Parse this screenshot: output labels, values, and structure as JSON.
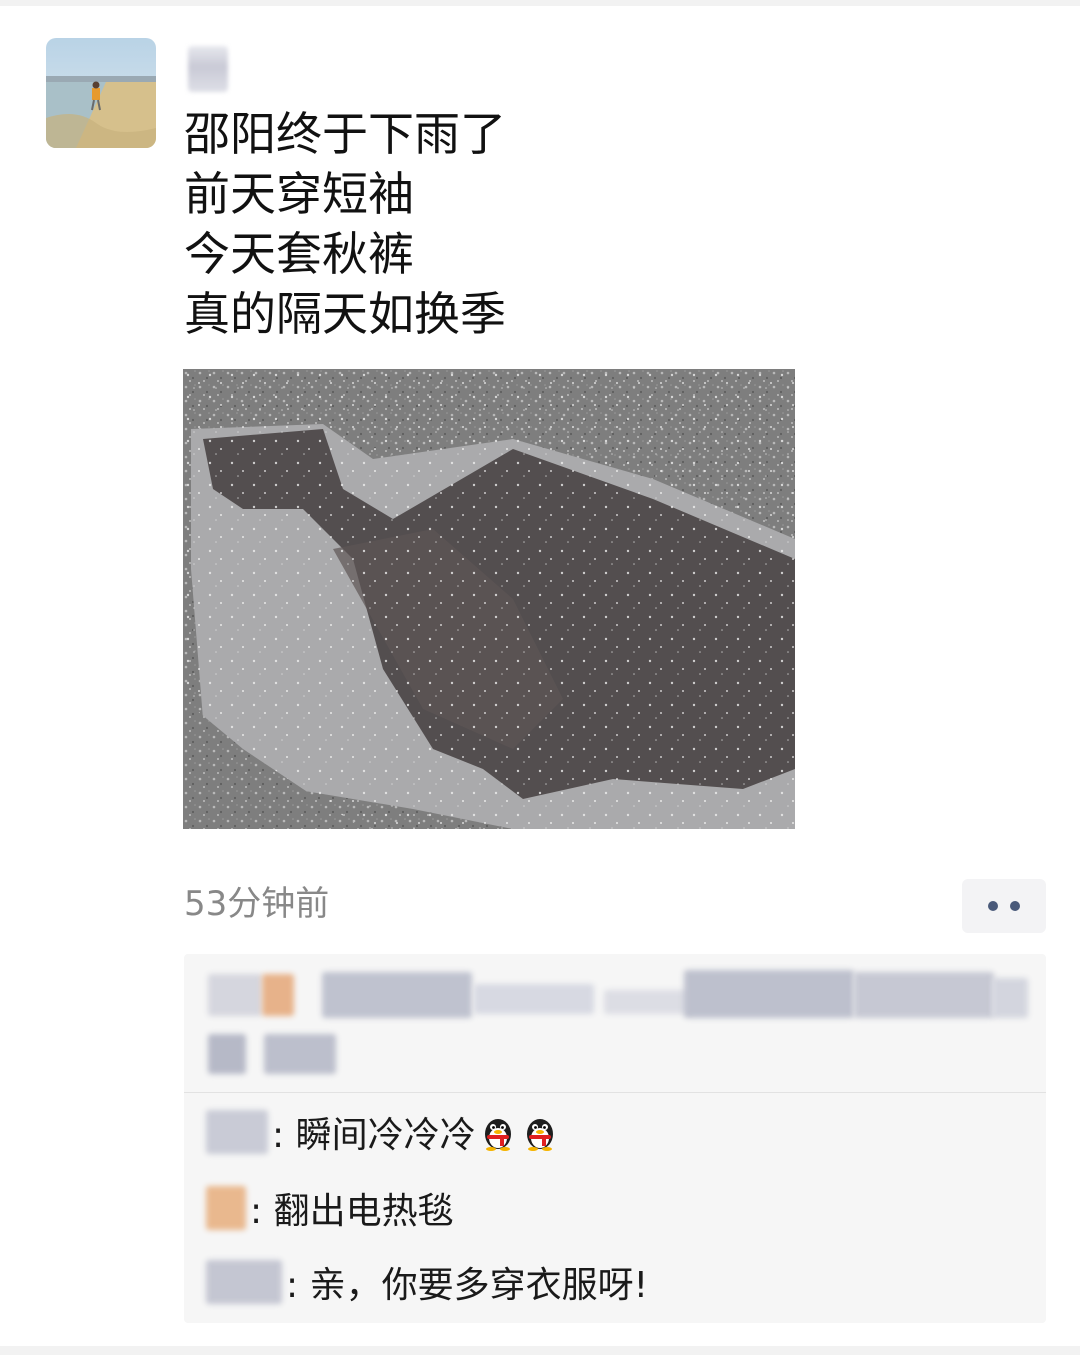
{
  "post": {
    "lines": [
      "邵阳终于下雨了",
      "前天穿短袖",
      "今天套秋裤",
      "真的隔天如换季"
    ],
    "time": "53分钟前"
  },
  "icons": {
    "more": "more-dots-icon",
    "emoji": "qq-penguin-emoji-icon"
  },
  "comments": [
    {
      "text": ": 瞬间冷冷冷",
      "emoji_count": 2
    },
    {
      "text": ": 翻出电热毯",
      "emoji_count": 0
    },
    {
      "text": ": 亲，你要多穿衣服呀!",
      "emoji_count": 0
    }
  ],
  "colors": {
    "text": "#111111",
    "time": "#888888",
    "comment_bg": "#f6f6f6",
    "more_dots": "#4a5a7a"
  }
}
